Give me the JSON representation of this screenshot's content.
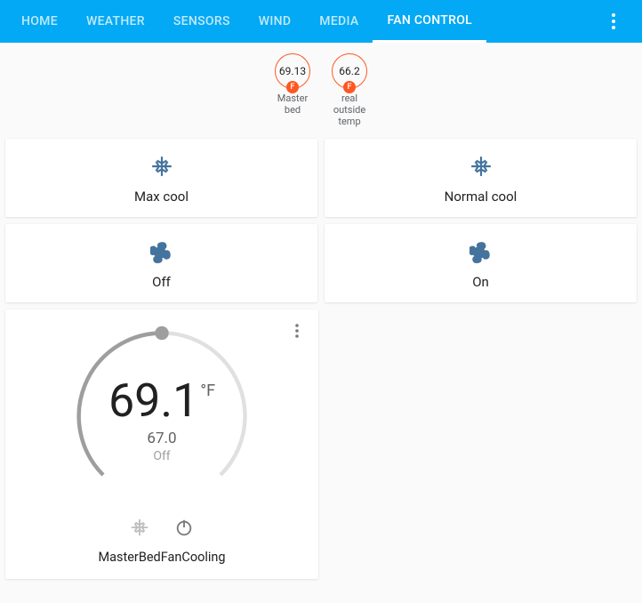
{
  "tabs": [
    "HOME",
    "WEATHER",
    "SENSORS",
    "WIND",
    "MEDIA",
    "FAN CONTROL"
  ],
  "activeTab": 5,
  "badges": [
    {
      "value": "69.13",
      "unit": "F",
      "label": "Master\nbed"
    },
    {
      "value": "66.2",
      "unit": "F",
      "label": "real\noutside\ntemp"
    }
  ],
  "cards": [
    {
      "icon": "snowflake",
      "label": "Max cool"
    },
    {
      "icon": "snowflake",
      "label": "Normal cool"
    },
    {
      "icon": "fan",
      "label": "Off"
    },
    {
      "icon": "fan",
      "label": "On"
    }
  ],
  "thermostat": {
    "current": "69.1",
    "unit": "°F",
    "setpoint": "67.0",
    "mode": "Off",
    "name": "MasterBedFanCooling"
  }
}
